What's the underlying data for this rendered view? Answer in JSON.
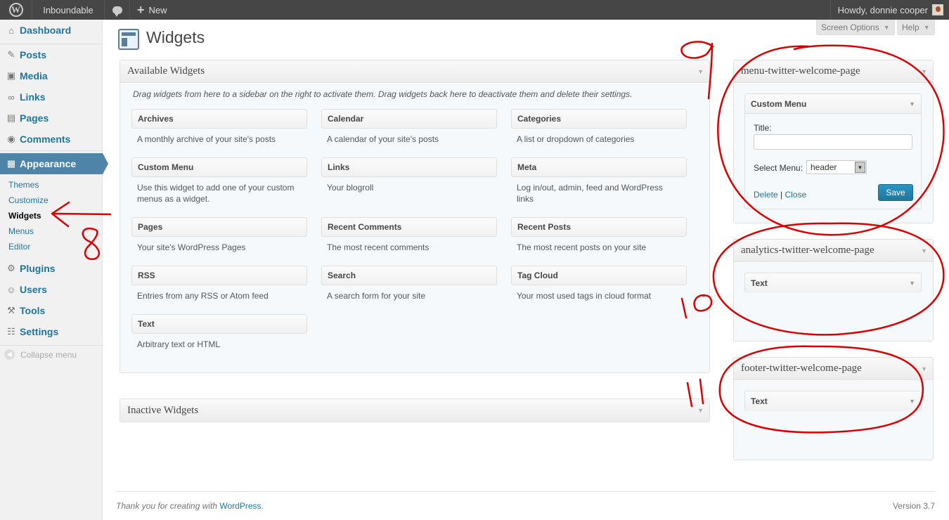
{
  "adminbar": {
    "wp_logo": "W",
    "site_name": "Inboundable",
    "new_label": "New",
    "greeting": "Howdy, donnie cooper"
  },
  "menu": {
    "dashboard": "Dashboard",
    "posts": "Posts",
    "media": "Media",
    "links": "Links",
    "pages": "Pages",
    "comments": "Comments",
    "appearance": "Appearance",
    "appearance_sub": [
      "Themes",
      "Customize",
      "Widgets",
      "Menus",
      "Editor"
    ],
    "plugins": "Plugins",
    "users": "Users",
    "tools": "Tools",
    "settings": "Settings",
    "collapse": "Collapse menu"
  },
  "page": {
    "title": "Widgets",
    "screen_options": "Screen Options",
    "help": "Help"
  },
  "available": {
    "title": "Available Widgets",
    "description": "Drag widgets from here to a sidebar on the right to activate them. Drag widgets back here to deactivate them and delete their settings.",
    "widgets": [
      {
        "title": "Archives",
        "desc": "A monthly archive of your site's posts"
      },
      {
        "title": "Calendar",
        "desc": "A calendar of your site's posts"
      },
      {
        "title": "Categories",
        "desc": "A list or dropdown of categories"
      },
      {
        "title": "Custom Menu",
        "desc": "Use this widget to add one of your custom menus as a widget."
      },
      {
        "title": "Links",
        "desc": "Your blogroll"
      },
      {
        "title": "Meta",
        "desc": "Log in/out, admin, feed and WordPress links"
      },
      {
        "title": "Pages",
        "desc": "Your site's WordPress Pages"
      },
      {
        "title": "Recent Comments",
        "desc": "The most recent comments"
      },
      {
        "title": "Recent Posts",
        "desc": "The most recent posts on your site"
      },
      {
        "title": "RSS",
        "desc": "Entries from any RSS or Atom feed"
      },
      {
        "title": "Search",
        "desc": "A search form for your site"
      },
      {
        "title": "Tag Cloud",
        "desc": "Your most used tags in cloud format"
      },
      {
        "title": "Text",
        "desc": "Arbitrary text or HTML"
      }
    ]
  },
  "inactive": {
    "title": "Inactive Widgets"
  },
  "sidebars": [
    {
      "title": "menu-twitter-welcome-page",
      "widget_title": "Custom Menu",
      "title_label": "Title:",
      "title_value": "",
      "select_label": "Select Menu:",
      "select_value": "header",
      "delete_label": "Delete",
      "separator": "|",
      "close_label": "Close",
      "save_label": "Save"
    },
    {
      "title": "analytics-twitter-welcome-page",
      "widget_title": "Text"
    },
    {
      "title": "footer-twitter-welcome-page",
      "widget_title": "Text"
    }
  ],
  "annotations": [
    "8",
    "9",
    "10",
    "11"
  ],
  "footer": {
    "thanks": "Thank you for creating with",
    "wordpress_link": "WordPress",
    "period": ".",
    "version": "Version 3.7"
  },
  "colors": {
    "adminbar_bg": "#464646",
    "link": "#21759b",
    "menu_current": "#4e84a8",
    "annotation_red": "#dd0000"
  },
  "icons": [
    "wordpress-logo-icon",
    "comment-bubble-icon",
    "plus-icon",
    "avatar-icon",
    "dashboard-icon",
    "posts-pin-icon",
    "media-icon",
    "links-icon",
    "pages-icon",
    "comments-icon",
    "appearance-icon",
    "plugins-icon",
    "users-icon",
    "tools-icon",
    "settings-icon",
    "collapse-arrow-icon",
    "chevron-down-icon"
  ]
}
